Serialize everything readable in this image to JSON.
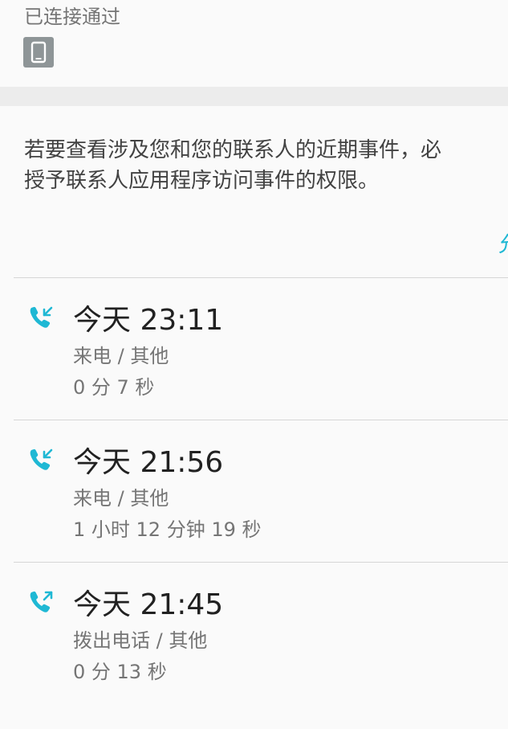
{
  "connected": {
    "label": "已连接通过",
    "device_icon": "tablet-device-icon"
  },
  "permission": {
    "notice": "若要查看涉及您和您的联系人的近期事件，必\n授予联系人应用程序访问事件的权限。",
    "action_label": "允"
  },
  "colors": {
    "accent": "#1fb8d4",
    "primary_text": "#212121",
    "secondary_text": "#757575",
    "divider": "#d6d6d6",
    "section_gap": "#ececec"
  },
  "calls": [
    {
      "time": "今天 23:11",
      "type": "来电 / 其他",
      "duration": "0 分 7 秒",
      "icon": "incoming-call-icon"
    },
    {
      "time": "今天 21:56",
      "type": "来电 / 其他",
      "duration": "1 小时 12 分钟 19 秒",
      "icon": "incoming-call-icon"
    },
    {
      "time": "今天 21:45",
      "type": "拨出电话 / 其他",
      "duration": "0 分 13 秒",
      "icon": "outgoing-call-icon"
    }
  ]
}
